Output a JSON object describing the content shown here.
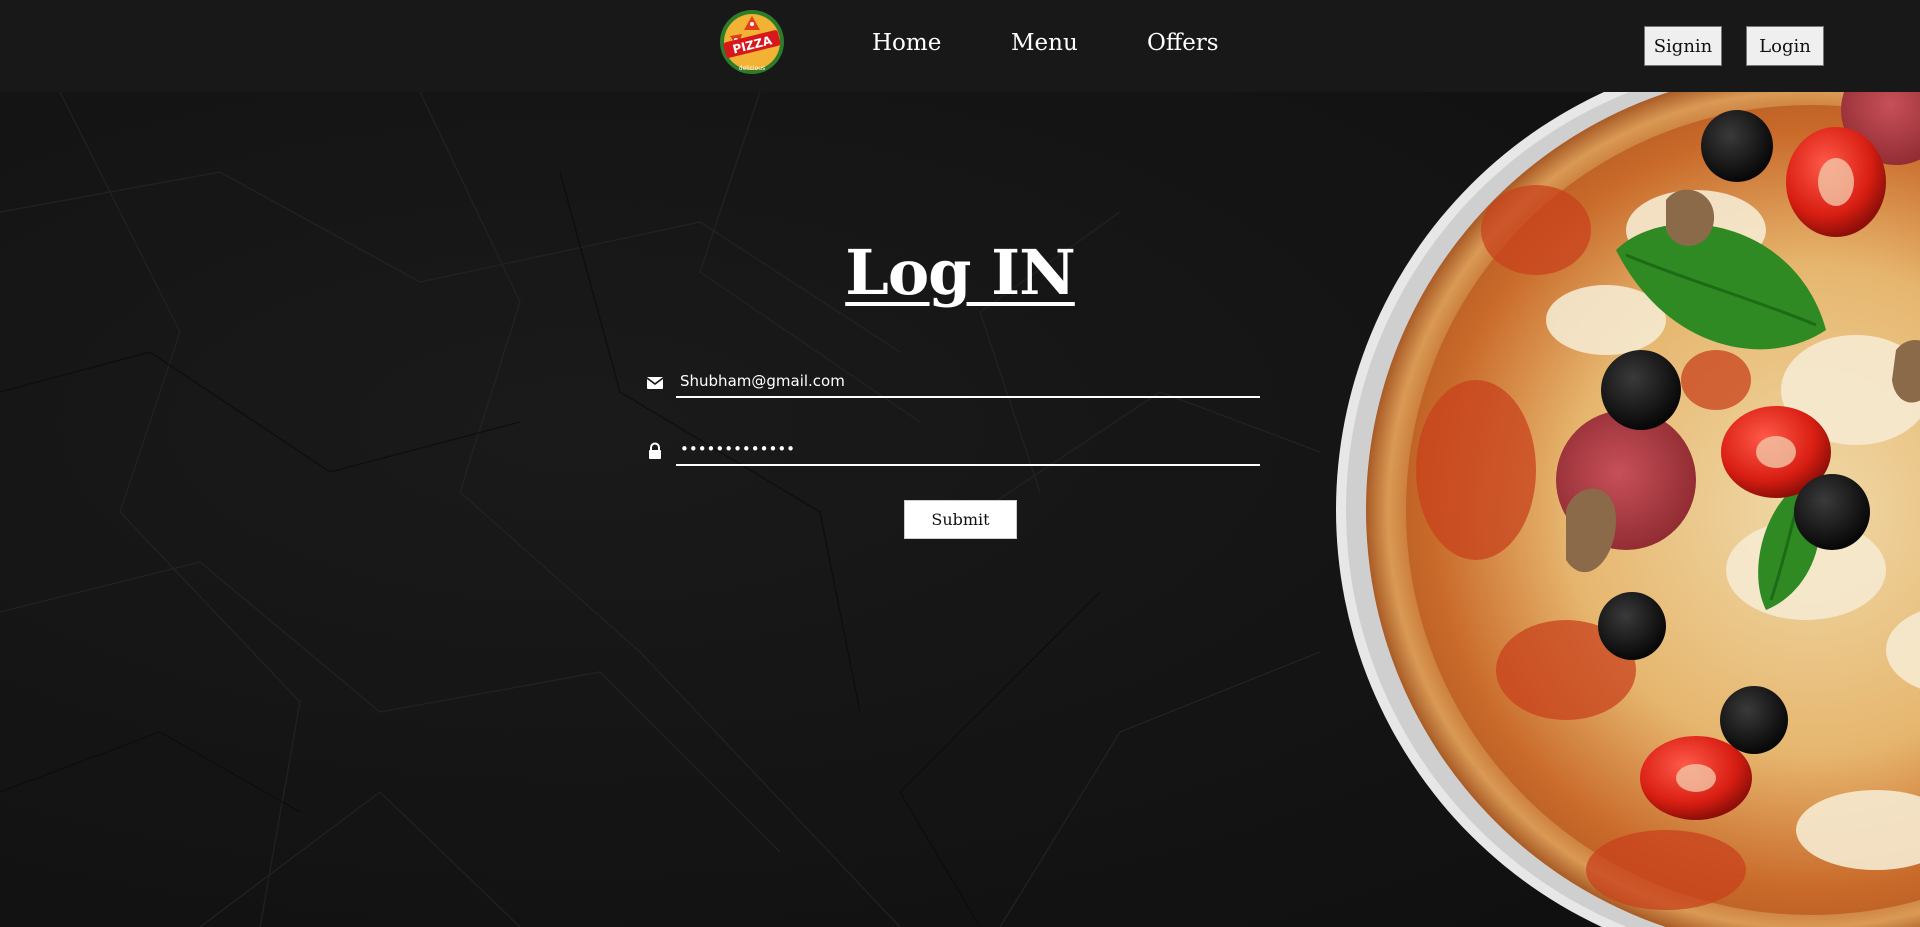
{
  "navbar": {
    "logo_text": "PIZZA",
    "logo_subtext": "delicious",
    "links": [
      {
        "label": "Home"
      },
      {
        "label": "Menu"
      },
      {
        "label": "Offers"
      }
    ],
    "signin_label": "Signin",
    "login_label": "Login"
  },
  "form": {
    "title": "Log IN",
    "email_value": "Shubham@gmail.com",
    "password_value": "shubham@12345",
    "submit_label": "Submit"
  },
  "icons": {
    "email": "envelope-icon",
    "password": "lock-icon"
  },
  "colors": {
    "background": "#131313",
    "navbar": "#181818",
    "text": "#ffffff"
  }
}
